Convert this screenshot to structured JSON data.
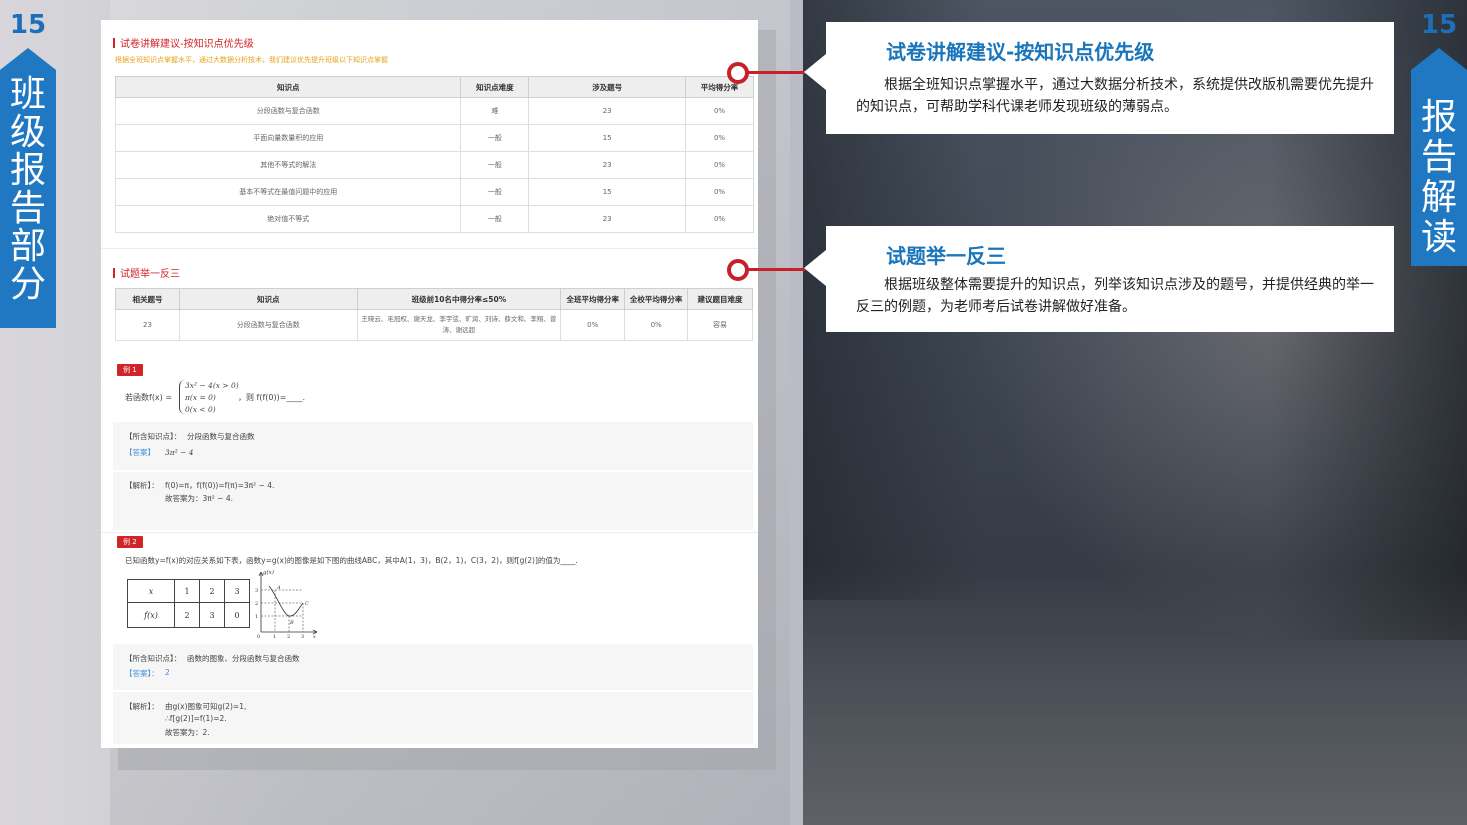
{
  "page_number": "15",
  "left_tab_label": [
    "班",
    "级",
    "报",
    "告",
    "部",
    "分"
  ],
  "right_tab_label": [
    "报",
    "告",
    "解",
    "读"
  ],
  "doc": {
    "section1_title": "试卷讲解建议-按知识点优先级",
    "section1_subtitle": "根据全班知识点掌握水平，通过大数据分析技术，我们建议优先提升班级以下知识点掌握",
    "table1": {
      "headers": [
        "知识点",
        "知识点难度",
        "涉及题号",
        "平均得分率"
      ],
      "rows": [
        [
          "分段函数与复合函数",
          "难",
          "23",
          "0%"
        ],
        [
          "平面向量数量积的应用",
          "一般",
          "15",
          "0%"
        ],
        [
          "其他不等式的解法",
          "一般",
          "23",
          "0%"
        ],
        [
          "基本不等式在最值问题中的应用",
          "一般",
          "15",
          "0%"
        ],
        [
          "绝对值不等式",
          "一般",
          "23",
          "0%"
        ]
      ]
    },
    "section2_title": "试题举一反三",
    "table2": {
      "headers": [
        "相关题号",
        "知识点",
        "班级前10名中得分率≤50%",
        "全班平均得分率",
        "全校平均得分率",
        "建议题目难度"
      ],
      "row": [
        "23",
        "分段函数与复合函数",
        "王晓云、毛冠权、谢天龙、李宇弦、旷润、刘诗、薛文和、李翔、曾涛、谢远超",
        "0%",
        "0%",
        "容易"
      ]
    },
    "example1": {
      "tag": "例 1",
      "question_prefix": "若函数f(x) =",
      "cases": [
        "3x² − 4(x > 0)",
        "π(x = 0)",
        "0(x < 0)"
      ],
      "question_suffix": "，则 f(f(0))=____.",
      "knowledge_label": "【所含知识点】：",
      "knowledge_value": "分段函数与复合函数",
      "answer_label": "【答案】",
      "answer_value": "3π² − 4",
      "analysis_label": "【解析】：",
      "analysis_line1": "f(0)=π，f(f(0))=f(π)=3π² − 4.",
      "analysis_line2": "故答案为：3π² − 4."
    },
    "example2": {
      "tag": "例 2",
      "question": "已知函数y=f(x)的对应关系如下表，函数y=g(x)的图像是如下图的曲线ABC，其中A(1，3)，B(2，1)，C(3，2)，则f[g(2)]的值为____.",
      "table": {
        "row1": [
          "x",
          "1",
          "2",
          "3"
        ],
        "row2": [
          "f(x)",
          "2",
          "3",
          "0"
        ]
      },
      "graph_labels": {
        "y": "g(x)",
        "x": "x",
        "o": "0",
        "a": "A",
        "b": "B",
        "c": "C",
        "y1": "1",
        "y2": "2",
        "y3": "3",
        "x1": "1",
        "x2": "2",
        "x3": "3"
      },
      "knowledge_label": "【所含知识点】：",
      "knowledge_value": "函数的图象、分段函数与复合函数",
      "answer_label": "【答案】：",
      "answer_value": "2",
      "analysis_label": "【解析】：",
      "analysis_line1": "由g(x)图象可知g(2)=1,",
      "analysis_line2": "∴f[g(2)]=f(1)=2.",
      "analysis_line3": "故答案为：2."
    }
  },
  "callout1": {
    "title": "试卷讲解建议-按知识点优先级",
    "text": "根据全班知识点掌握水平，通过大数据分析技术，系统提供改版机需要优先提升的知识点，可帮助学科代课老师发现班级的薄弱点。"
  },
  "callout2": {
    "title": "试题举一反三",
    "text": "根据班级整体需要提升的知识点，列举该知识点涉及的题号，并提供经典的举一反三的例题，为老师考后试卷讲解做好准备。"
  },
  "colors": {
    "accent_blue": "#1f78c1",
    "accent_red": "#c8202a",
    "title_blue": "#1b75bb"
  }
}
